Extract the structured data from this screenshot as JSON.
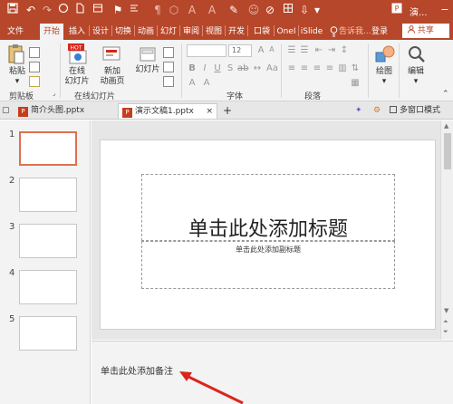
{
  "titlebar": {
    "title": "演...",
    "quick_access": {
      "save": "save-icon",
      "undo": "undo-icon",
      "redo": "redo-icon"
    },
    "window_buttons": {
      "minimize": "−",
      "maximize": "□",
      "close": "×"
    }
  },
  "tabs": [
    {
      "label": "文件"
    },
    {
      "label": "开始"
    },
    {
      "label": "插入"
    },
    {
      "label": "设计"
    },
    {
      "label": "切换"
    },
    {
      "label": "动画"
    },
    {
      "label": "幻灯"
    },
    {
      "label": "审阅"
    },
    {
      "label": "视图"
    },
    {
      "label": "开发"
    },
    {
      "label": "口袋"
    },
    {
      "label": "OneI"
    },
    {
      "label": "iSlide"
    }
  ],
  "tell_me": "告诉我...",
  "login": "登录",
  "share": "共享",
  "ribbon": {
    "clipboard": {
      "paste": "粘贴",
      "group": "剪贴板"
    },
    "slides": {
      "new_online": "在线\n幻灯片",
      "new_slide": "新加\n动画页",
      "layout": "幻灯片",
      "group": "在线幻灯片"
    },
    "font": {
      "size": "12",
      "group": "字体"
    },
    "paragraph": {
      "group": "段落"
    },
    "drawing": {
      "label": "绘图"
    },
    "editing": {
      "label": "编辑"
    }
  },
  "doc_tabs": {
    "tab1": "简介头图.pptx",
    "tab2": "演示文稿1.pptx",
    "add": "+",
    "multi_window": "多窗口模式"
  },
  "slides": [
    {
      "num": "1"
    },
    {
      "num": "2"
    },
    {
      "num": "3"
    },
    {
      "num": "4"
    },
    {
      "num": "5"
    }
  ],
  "slide": {
    "title_placeholder": "单击此处添加标题",
    "subtitle_placeholder": "单击此处添加副标题"
  },
  "notes": {
    "placeholder": "单击此处添加备注"
  },
  "colors": {
    "accent": "#b7472a",
    "selection": "#e0704f",
    "arrow": "#d9261c"
  }
}
